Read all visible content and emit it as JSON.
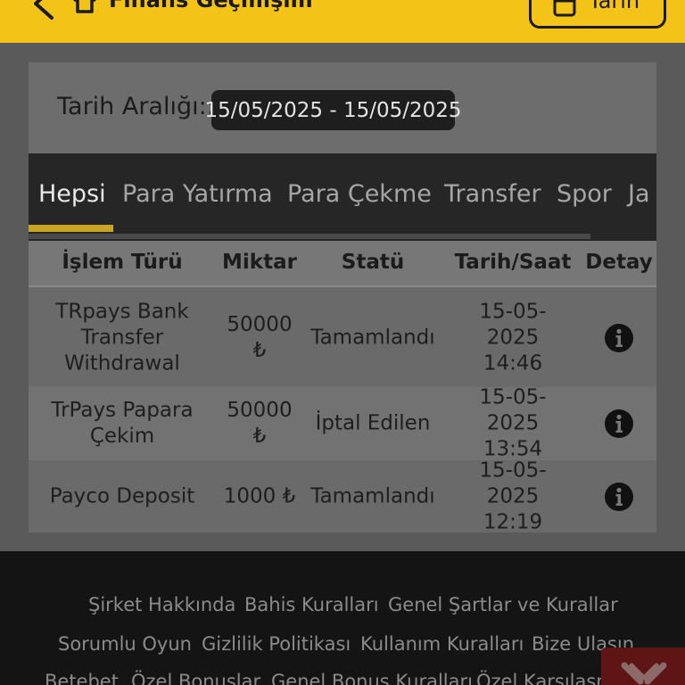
{
  "header": {
    "title": "Finans Geçmişim",
    "date_button_label": "Tarih"
  },
  "filter": {
    "label": "Tarih Aralığı::",
    "date_range": "15/05/2025 - 15/05/2025"
  },
  "tabs": [
    {
      "label": "Hepsi",
      "active": true
    },
    {
      "label": "Para Yatırma",
      "active": false
    },
    {
      "label": "Para Çekme",
      "active": false
    },
    {
      "label": "Transfer",
      "active": false
    },
    {
      "label": "Spor",
      "active": false
    },
    {
      "label": "Ja",
      "active": false
    }
  ],
  "table": {
    "columns": [
      "İşlem Türü",
      "Miktar",
      "Statü",
      "Tarih/Saat",
      "Detay"
    ],
    "rows": [
      {
        "type": "TRpays Bank Transfer Withdrawal",
        "amount": "50000 ₺",
        "status": "Tamamlandı",
        "datetime": "15-05-2025 14:46",
        "detail_icon": "info-icon"
      },
      {
        "type": "TrPays Papara Çekim",
        "amount": "50000 ₺",
        "status": "İptal Edilen",
        "datetime": "15-05-2025 13:54",
        "detail_icon": "info-icon"
      },
      {
        "type": "Payco Deposit",
        "amount": "1000 ₺",
        "status": "Tamamlandı",
        "datetime": "15-05-2025 12:19",
        "detail_icon": "info-icon"
      }
    ]
  },
  "footer": {
    "links_row1": [
      "Şirket Hakkında",
      "Bahis Kuralları",
      "Genel Şartlar ve Kurallar"
    ],
    "links_row2": [
      "Sorumlu Oyun",
      "Gizlilik Politikası",
      "Kullanım Kuralları",
      "Bize Ulaşın"
    ],
    "links_row3": [
      "Betebet",
      "Özel Bonuslar",
      "Genel Bonus Kuralları",
      "Özel Karşılaşm"
    ]
  },
  "colors": {
    "header_bg": "#f3c317",
    "accent_underline": "#c9a525",
    "chat_badge": "#5f1515"
  },
  "icons": {
    "back": "back-arrow-icon",
    "home": "home-icon",
    "calendar": "calendar-icon",
    "detail": "info-icon",
    "chat": "chat-icon"
  }
}
